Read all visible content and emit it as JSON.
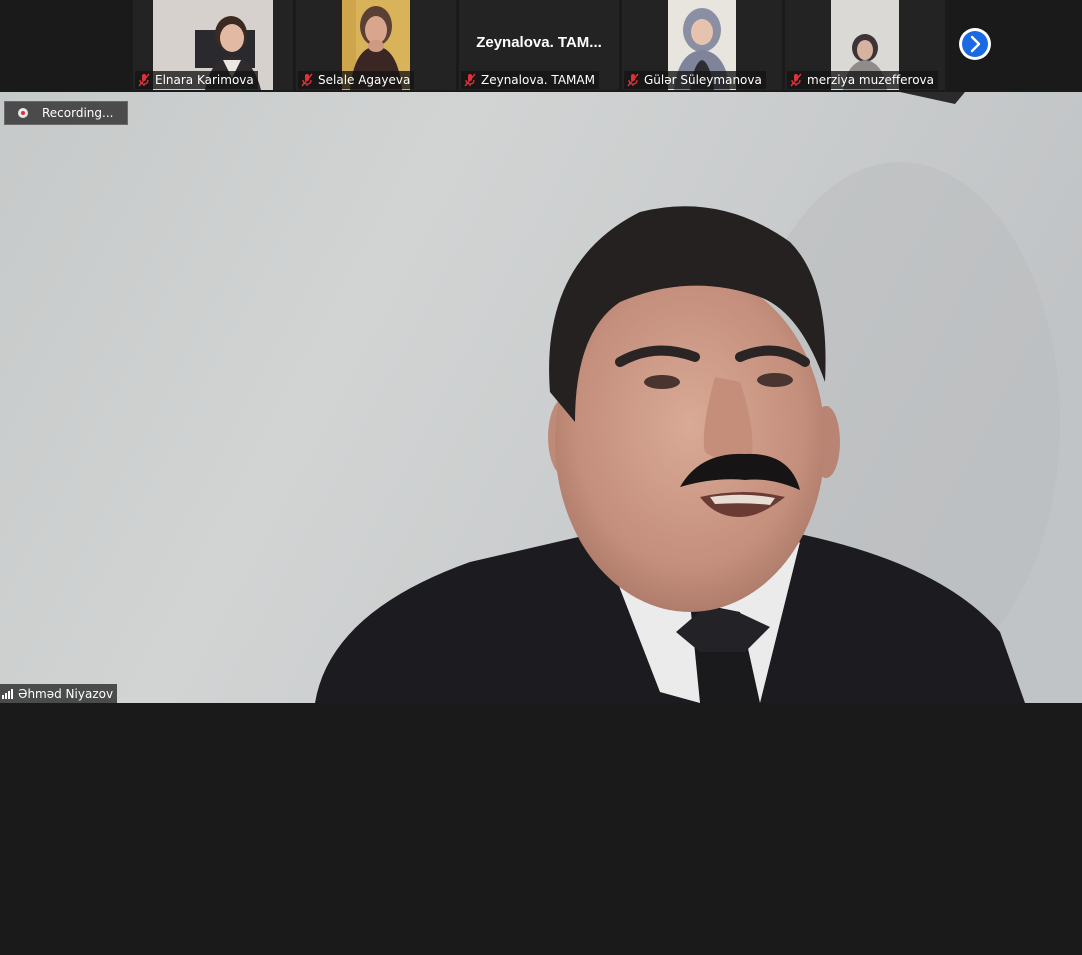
{
  "participants": [
    {
      "name": "Elnara Karimova",
      "muted": true,
      "video": true
    },
    {
      "name": "Selale Agayeva",
      "muted": true,
      "video": true
    },
    {
      "name": "Zeynalova. TAMAM",
      "display_title": "Zeynalova.  TAM...",
      "muted": true,
      "video": false
    },
    {
      "name": "Gülər Süleymanova",
      "muted": true,
      "video": true
    },
    {
      "name": "merziya muzefferova",
      "muted": true,
      "video": true
    }
  ],
  "recording": {
    "label": "Recording..."
  },
  "active_speaker": {
    "name": "Əhməd Niyazov"
  },
  "icons": {
    "mute": "muted-microphone-icon",
    "next": "chevron-right-icon",
    "signal": "signal-strength-icon",
    "recording": "recording-dot-icon"
  },
  "colors": {
    "background": "#1a1a1a",
    "tile": "#232323",
    "mute_icon": "#e0313a",
    "next_button": "#1b6ae3"
  }
}
